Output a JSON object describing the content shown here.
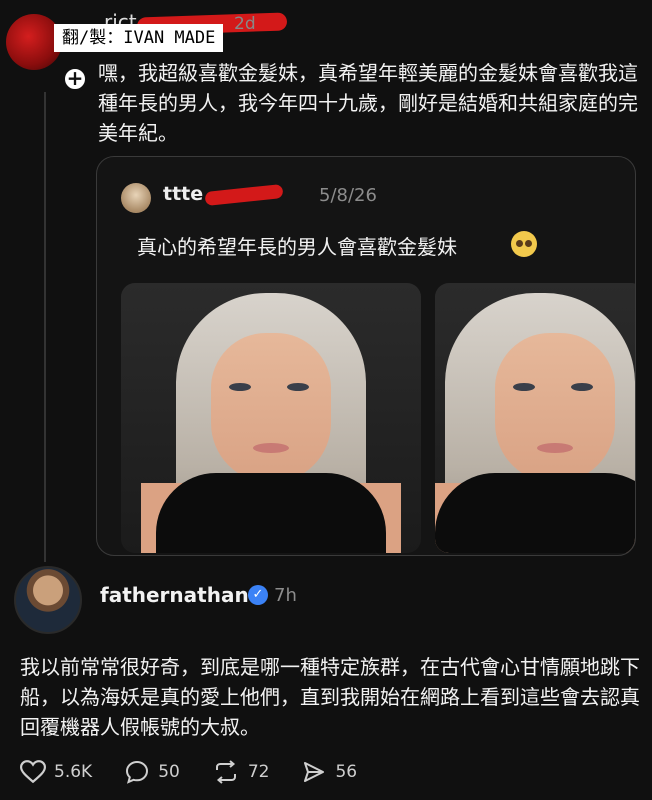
{
  "watermark": "翻/製：IVAN MADE",
  "top_post": {
    "username_visible": "rict",
    "time": "2d",
    "text": "嘿，我超級喜歡金髮妹，真希望年輕美麗的金髮妹會喜歡我這種年長的男人，我今年四十九歲，剛好是結婚和共組家庭的完美年紀。"
  },
  "quoted_post": {
    "username_visible": "ttte",
    "date": "5/8/26",
    "text": "真心的希望年長的男人會喜歡金髮妹",
    "emoji": "pleading-face"
  },
  "reply": {
    "username": "fathernathan",
    "time": "7h",
    "text": "我以前常常很好奇，到底是哪一種特定族群，在古代會心甘情願地跳下船，以為海妖是真的愛上他們，直到我開始在網路上看到這些會去認真回覆機器人假帳號的大叔。",
    "verified_color": "#3b82f6"
  },
  "actions": {
    "likes": "5.6K",
    "comments": "50",
    "reposts": "72",
    "shares": "56"
  },
  "colors": {
    "background": "#101010",
    "scribble": "#d31919"
  }
}
